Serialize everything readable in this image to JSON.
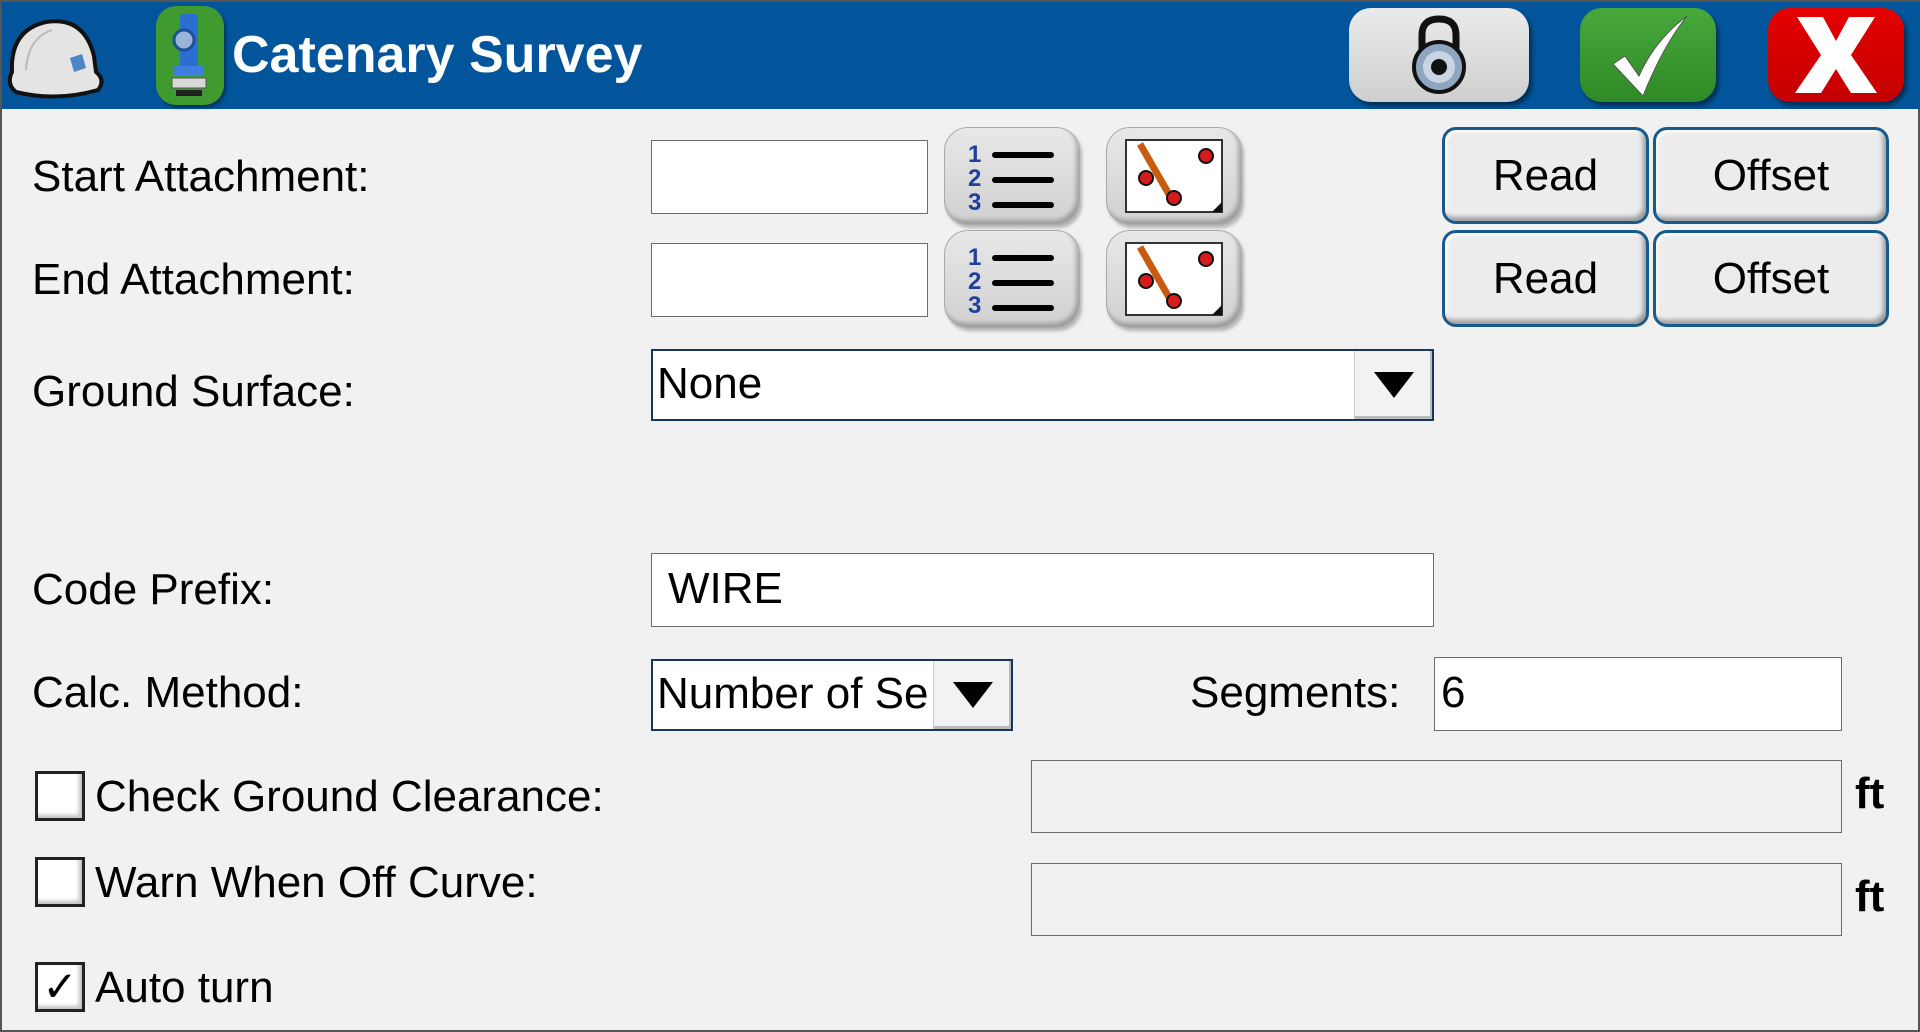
{
  "header": {
    "title": "Catenary Survey",
    "icons": [
      "hard-hat-icon",
      "total-station-icon",
      "lock-icon",
      "checkmark-icon",
      "close-x-icon"
    ]
  },
  "form": {
    "start_attachment": {
      "label": "Start Attachment:",
      "value": "",
      "read_label": "Read",
      "offset_label": "Offset"
    },
    "end_attachment": {
      "label": "End Attachment:",
      "value": "",
      "read_label": "Read",
      "offset_label": "Offset"
    },
    "ground_surface": {
      "label": "Ground Surface:",
      "selected": "None"
    },
    "code_prefix": {
      "label": "Code Prefix:",
      "value": "WIRE"
    },
    "calc_method": {
      "label": "Calc. Method:",
      "selected": "Number of Se"
    },
    "segments": {
      "label": "Segments:",
      "value": "6"
    },
    "check_ground_clearance": {
      "label": "Check Ground Clearance:",
      "checked": false,
      "value": "",
      "unit": "ft"
    },
    "warn_off_curve": {
      "label": "Warn When Off Curve:",
      "checked": false,
      "value": "",
      "unit": "ft"
    },
    "auto_turn": {
      "label": "Auto turn",
      "checked": true,
      "check_glyph": "✓"
    }
  },
  "colors": {
    "header_bg": "#03559b",
    "accept_green": "#3c9a32",
    "cancel_red": "#d90000",
    "button_border": "#195a8c"
  }
}
